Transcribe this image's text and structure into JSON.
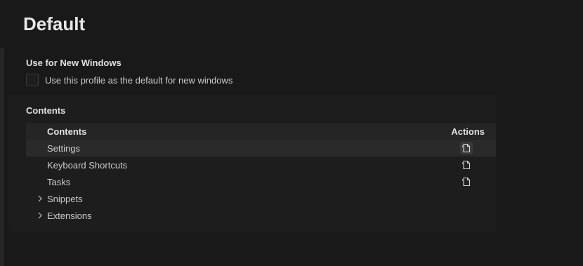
{
  "profile": {
    "title": "Default"
  },
  "new_windows": {
    "heading": "Use for New Windows",
    "checkbox_label": "Use this profile as the default for new windows",
    "checked": false
  },
  "contents": {
    "heading": "Contents",
    "columns": {
      "contents": "Contents",
      "actions": "Actions"
    },
    "rows": [
      {
        "label": "Settings",
        "expandable": false,
        "action_icon": "new-file-icon",
        "selected": true
      },
      {
        "label": "Keyboard Shortcuts",
        "expandable": false,
        "action_icon": "new-file-icon",
        "selected": false
      },
      {
        "label": "Tasks",
        "expandable": false,
        "action_icon": "new-file-icon",
        "selected": false
      },
      {
        "label": "Snippets",
        "expandable": true,
        "action_icon": "chevron-right-icon",
        "selected": false
      },
      {
        "label": "Extensions",
        "expandable": true,
        "action_icon": "chevron-right-icon",
        "selected": false
      }
    ]
  },
  "colors": {
    "background": "#191919",
    "panel": "#1d1d1d",
    "header_row": "#252525",
    "selected_row": "#2a2a2a"
  }
}
